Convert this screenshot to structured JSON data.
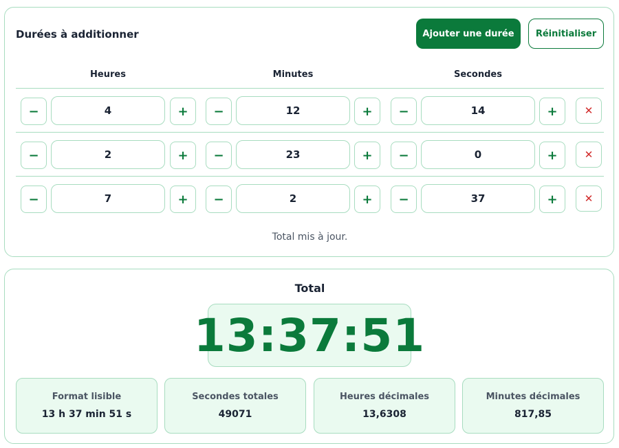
{
  "durations": {
    "title": "Durées à additionner",
    "add_button": "Ajouter une durée",
    "reset_button": "Réinitialiser",
    "columns": [
      "Heures",
      "Minutes",
      "Secondes"
    ],
    "decrement_symbol": "−",
    "increment_symbol": "+",
    "delete_symbol": "✕",
    "rows": [
      {
        "hours": "4",
        "minutes": "12",
        "seconds": "14"
      },
      {
        "hours": "2",
        "minutes": "23",
        "seconds": "0"
      },
      {
        "hours": "7",
        "minutes": "2",
        "seconds": "37"
      }
    ],
    "status": "Total mis à jour."
  },
  "total": {
    "title": "Total",
    "value": "13:37:51",
    "stats": [
      {
        "label": "Format lisible",
        "value": "13 h 37 min 51 s"
      },
      {
        "label": "Secondes totales",
        "value": "49071"
      },
      {
        "label": "Heures décimales",
        "value": "13,6308"
      },
      {
        "label": "Minutes décimales",
        "value": "817,85"
      }
    ]
  },
  "colors": {
    "accent": "#0b7a3b",
    "border": "#a7dcbf",
    "panel_bg": "#eafaf0",
    "danger": "#d12a2a"
  }
}
